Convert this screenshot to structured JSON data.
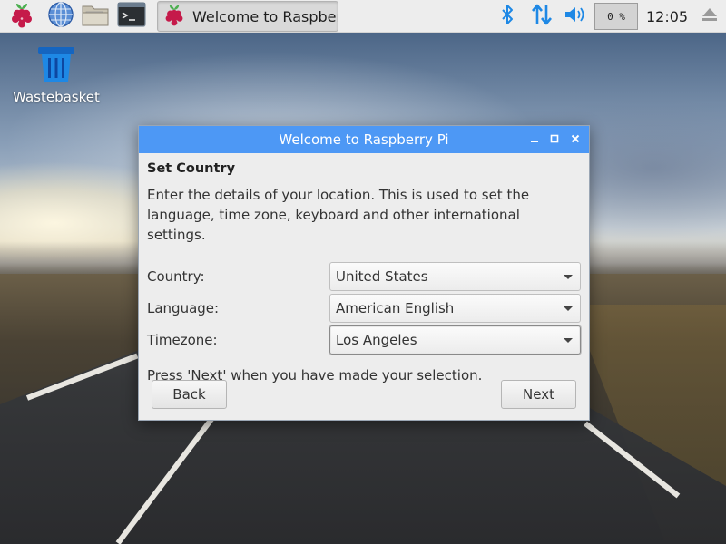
{
  "taskbar": {
    "launchers": [
      {
        "icon": "raspberry-menu-icon"
      },
      {
        "icon": "web-browser-icon"
      },
      {
        "icon": "file-manager-icon"
      },
      {
        "icon": "terminal-icon"
      }
    ],
    "task_window_label": "Welcome to Raspberr…",
    "cpu_usage": "0 %",
    "clock": "12:05"
  },
  "desktop": {
    "icons": [
      {
        "label": "Wastebasket",
        "icon": "wastebasket-icon"
      }
    ]
  },
  "dialog": {
    "title": "Welcome to Raspberry Pi",
    "heading": "Set Country",
    "description": "Enter the details of your location. This is used to set the language, time zone, keyboard and other international settings.",
    "fields": [
      {
        "label": "Country:",
        "value": "United States"
      },
      {
        "label": "Language:",
        "value": "American English"
      },
      {
        "label": "Timezone:",
        "value": "Los Angeles"
      }
    ],
    "hint": "Press 'Next' when you have made your selection.",
    "buttons": {
      "back": "Back",
      "next": "Next"
    }
  },
  "colors": {
    "titlebar": "#4d98f5",
    "panel": "#ededed",
    "raspberry_red": "#c51a4a",
    "tray_blue": "#1e88e5"
  }
}
